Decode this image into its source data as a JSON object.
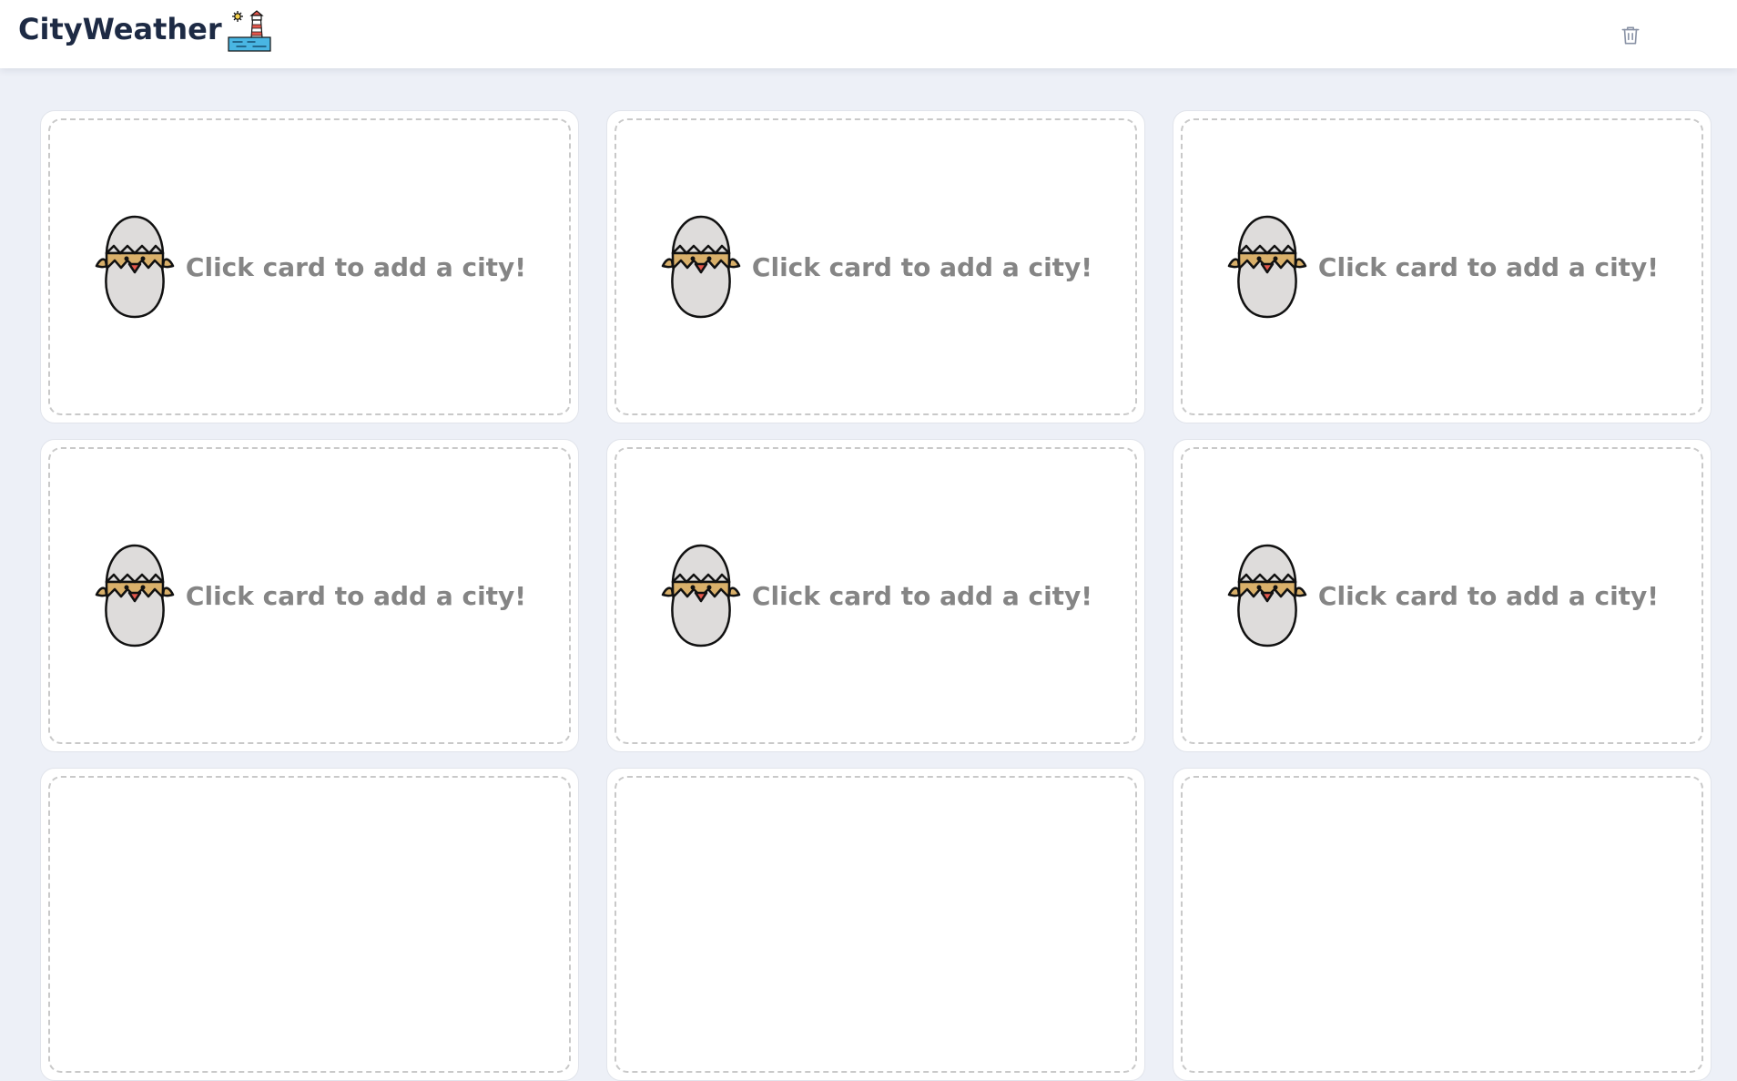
{
  "header": {
    "title": "CityWeather",
    "logo_icon": "lighthouse-icon",
    "actions": {
      "delete_icon": "trash-icon"
    }
  },
  "cards": [
    {
      "label": "Click card to add a city!",
      "icon": "hatching-chick-icon"
    },
    {
      "label": "Click card to add a city!",
      "icon": "hatching-chick-icon"
    },
    {
      "label": "Click card to add a city!",
      "icon": "hatching-chick-icon"
    },
    {
      "label": "Click card to add a city!",
      "icon": "hatching-chick-icon"
    },
    {
      "label": "Click card to add a city!",
      "icon": "hatching-chick-icon"
    },
    {
      "label": "Click card to add a city!",
      "icon": "hatching-chick-icon"
    },
    {
      "label": "",
      "icon": ""
    },
    {
      "label": "",
      "icon": ""
    },
    {
      "label": "",
      "icon": ""
    }
  ],
  "colors": {
    "page_background": "#edf0f7",
    "header_background": "#ffffff",
    "title_color": "#1d2a44",
    "card_text": "#858585",
    "dashed_border": "#c9c9c9"
  }
}
